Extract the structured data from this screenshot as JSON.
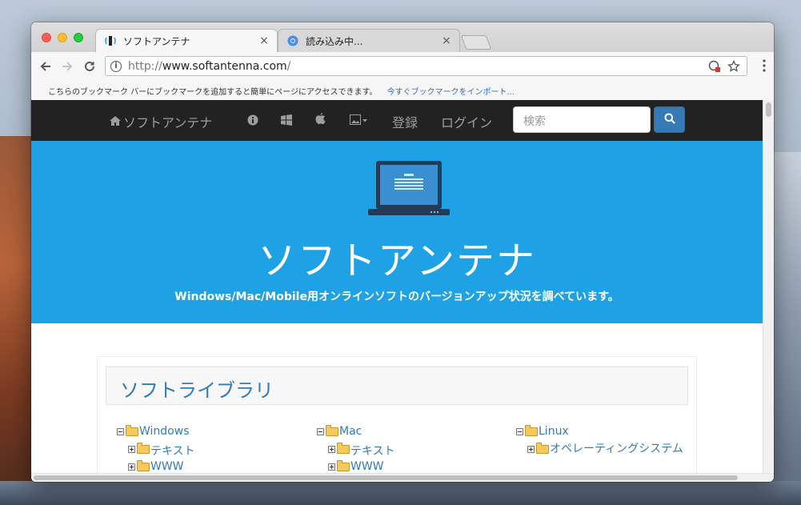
{
  "browser": {
    "tabs": [
      {
        "title": "ソフトアンテナ",
        "active": true,
        "close": "×"
      },
      {
        "title": "読み込み中...",
        "active": false,
        "close": "×"
      }
    ],
    "address": {
      "protocol": "http://",
      "host": "www.softantenna.com",
      "path": "/"
    },
    "bookmark_bar": {
      "message": "こちらのブックマーク バーにブックマークを追加すると簡単にページにアクセスできます。",
      "import_link": "今すぐブックマークをインポート..."
    }
  },
  "site": {
    "nav": {
      "brand": "ソフトアンテナ",
      "register": "登録",
      "login": "ログイン",
      "search_placeholder": "検索"
    },
    "hero": {
      "title": "ソフトアンテナ",
      "subtitle": "Windows/Mac/Mobile用オンラインソフトのバージョンアップ状況を調べています。"
    },
    "library": {
      "heading": "ソフトライブラリ",
      "columns": [
        {
          "root": "Windows",
          "children": [
            "テキスト",
            "WWW"
          ]
        },
        {
          "root": "Mac",
          "children": [
            "テキスト",
            "WWW"
          ]
        },
        {
          "root": "Linux",
          "children": [
            "オペレーティングシステム"
          ]
        }
      ]
    },
    "colors": {
      "navbar": "#222222",
      "hero": "#1ea1e5",
      "link": "#337ab7",
      "search_button": "#337ab7"
    }
  }
}
